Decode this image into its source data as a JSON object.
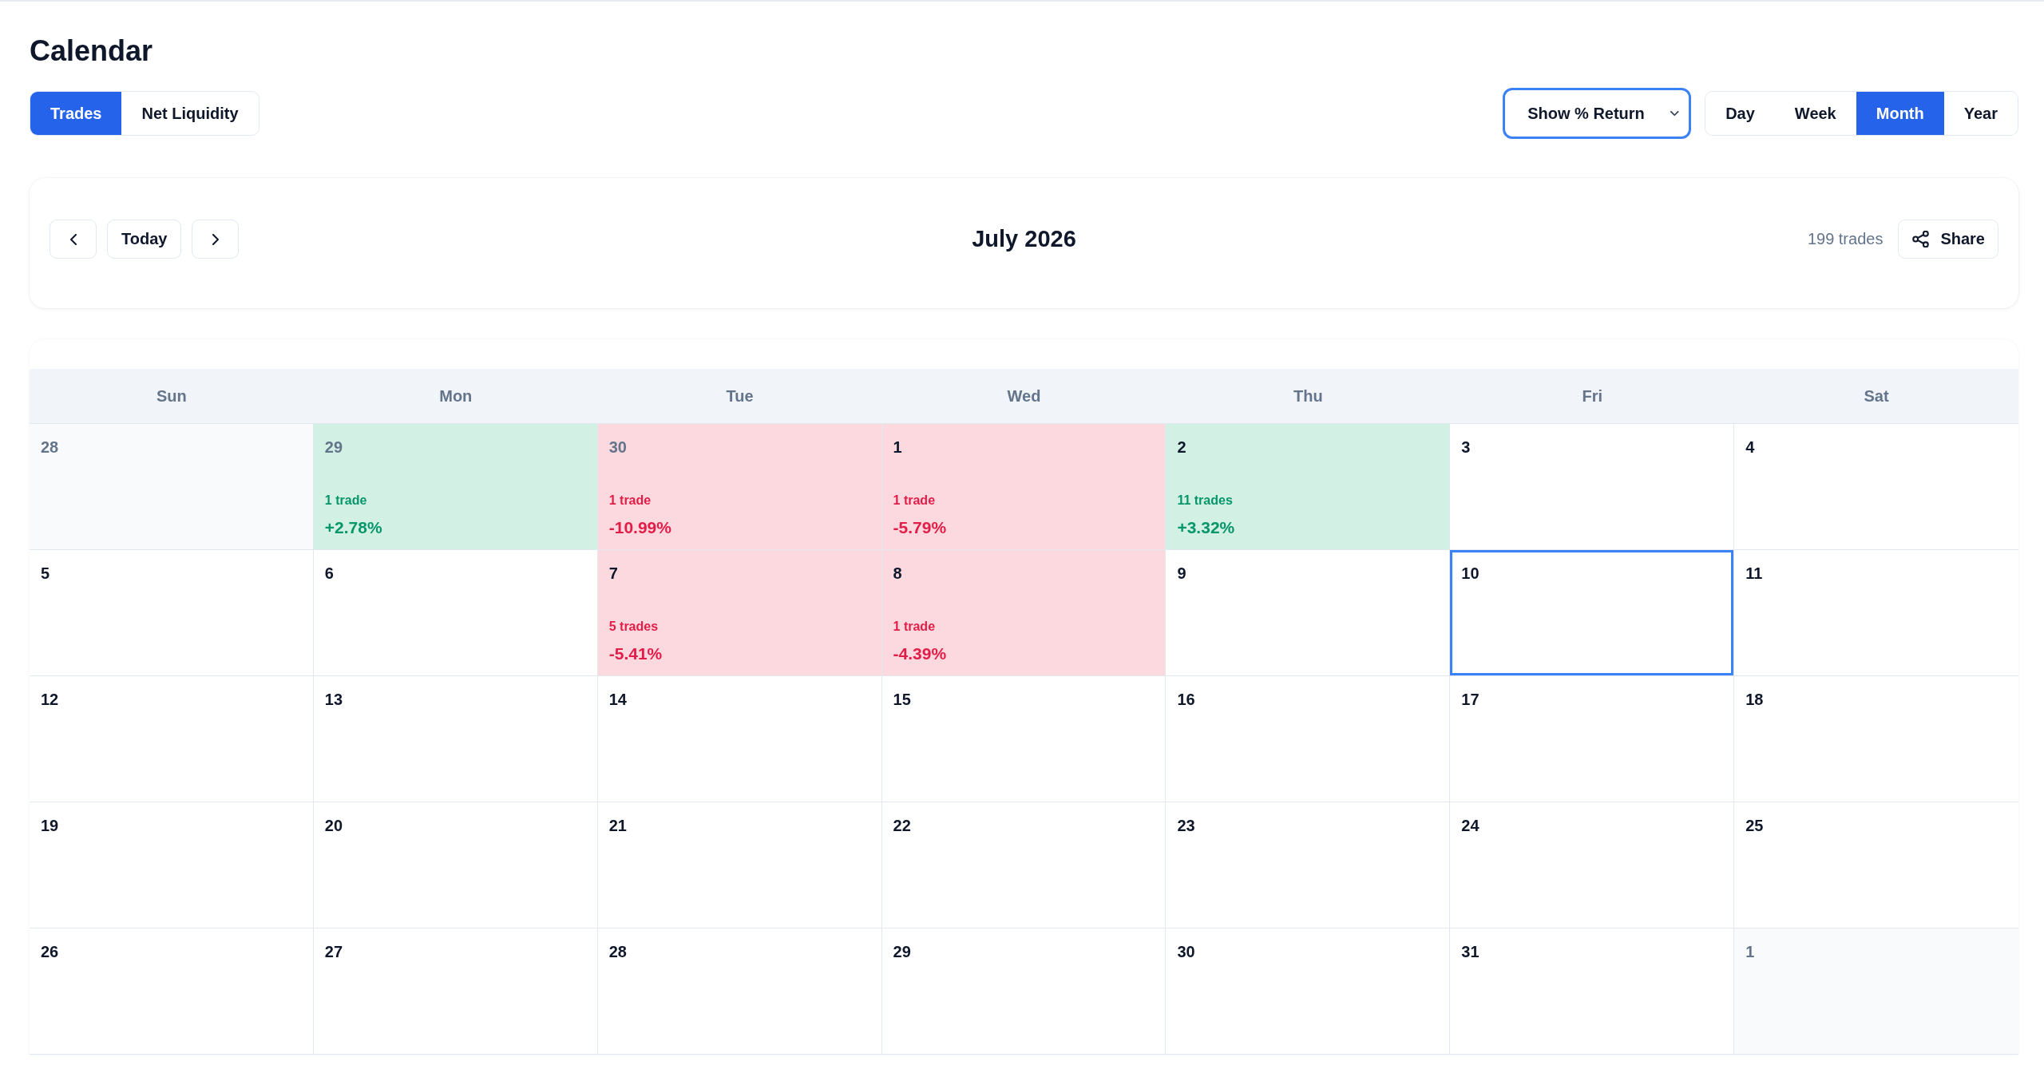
{
  "page": {
    "title": "Calendar"
  },
  "data_tabs": [
    {
      "label": "Trades",
      "selected": true
    },
    {
      "label": "Net Liquidity",
      "selected": false
    }
  ],
  "return_select": {
    "value": "Show % Return",
    "focused": true
  },
  "view_tabs": [
    {
      "label": "Day",
      "selected": false
    },
    {
      "label": "Week",
      "selected": false
    },
    {
      "label": "Month",
      "selected": true
    },
    {
      "label": "Year",
      "selected": false
    }
  ],
  "navigation": {
    "today_button": "Today",
    "month_title": "July 2026",
    "trade_total": "199 trades",
    "share_button": "Share"
  },
  "calendar": {
    "weekdays": [
      "Sun",
      "Mon",
      "Tue",
      "Wed",
      "Thu",
      "Fri",
      "Sat"
    ],
    "weeks": [
      {
        "days": [
          {
            "date": "28",
            "outside_month": true,
            "today": false,
            "kind": "plain"
          },
          {
            "date": "29",
            "outside_month": true,
            "today": false,
            "kind": "gain",
            "trades": "1 trade",
            "return": "+2.78%"
          },
          {
            "date": "30",
            "outside_month": true,
            "today": false,
            "kind": "loss",
            "trades": "1 trade",
            "return": "-10.99%"
          },
          {
            "date": "1",
            "outside_month": false,
            "today": false,
            "kind": "loss",
            "trades": "1 trade",
            "return": "-5.79%"
          },
          {
            "date": "2",
            "outside_month": false,
            "today": false,
            "kind": "gain",
            "trades": "11 trades",
            "return": "+3.32%"
          },
          {
            "date": "3",
            "outside_month": false,
            "today": false,
            "kind": "plain"
          },
          {
            "date": "4",
            "outside_month": false,
            "today": false,
            "kind": "plain"
          }
        ]
      },
      {
        "days": [
          {
            "date": "5",
            "outside_month": false,
            "today": false,
            "kind": "plain"
          },
          {
            "date": "6",
            "outside_month": false,
            "today": false,
            "kind": "plain"
          },
          {
            "date": "7",
            "outside_month": false,
            "today": false,
            "kind": "loss",
            "trades": "5 trades",
            "return": "-5.41%"
          },
          {
            "date": "8",
            "outside_month": false,
            "today": false,
            "kind": "loss",
            "trades": "1 trade",
            "return": "-4.39%"
          },
          {
            "date": "9",
            "outside_month": false,
            "today": false,
            "kind": "plain"
          },
          {
            "date": "10",
            "outside_month": false,
            "today": true,
            "kind": "plain"
          },
          {
            "date": "11",
            "outside_month": false,
            "today": false,
            "kind": "plain"
          }
        ]
      },
      {
        "days": [
          {
            "date": "12",
            "outside_month": false,
            "today": false,
            "kind": "plain"
          },
          {
            "date": "13",
            "outside_month": false,
            "today": false,
            "kind": "plain"
          },
          {
            "date": "14",
            "outside_month": false,
            "today": false,
            "kind": "plain"
          },
          {
            "date": "15",
            "outside_month": false,
            "today": false,
            "kind": "plain"
          },
          {
            "date": "16",
            "outside_month": false,
            "today": false,
            "kind": "plain"
          },
          {
            "date": "17",
            "outside_month": false,
            "today": false,
            "kind": "plain"
          },
          {
            "date": "18",
            "outside_month": false,
            "today": false,
            "kind": "plain"
          }
        ]
      },
      {
        "days": [
          {
            "date": "19",
            "outside_month": false,
            "today": false,
            "kind": "plain"
          },
          {
            "date": "20",
            "outside_month": false,
            "today": false,
            "kind": "plain"
          },
          {
            "date": "21",
            "outside_month": false,
            "today": false,
            "kind": "plain"
          },
          {
            "date": "22",
            "outside_month": false,
            "today": false,
            "kind": "plain"
          },
          {
            "date": "23",
            "outside_month": false,
            "today": false,
            "kind": "plain"
          },
          {
            "date": "24",
            "outside_month": false,
            "today": false,
            "kind": "plain"
          },
          {
            "date": "25",
            "outside_month": false,
            "today": false,
            "kind": "plain"
          }
        ]
      },
      {
        "days": [
          {
            "date": "26",
            "outside_month": false,
            "today": false,
            "kind": "plain"
          },
          {
            "date": "27",
            "outside_month": false,
            "today": false,
            "kind": "plain"
          },
          {
            "date": "28",
            "outside_month": false,
            "today": false,
            "kind": "plain"
          },
          {
            "date": "29",
            "outside_month": false,
            "today": false,
            "kind": "plain"
          },
          {
            "date": "30",
            "outside_month": false,
            "today": false,
            "kind": "plain"
          },
          {
            "date": "31",
            "outside_month": false,
            "today": false,
            "kind": "plain"
          },
          {
            "date": "1",
            "outside_month": true,
            "today": false,
            "kind": "plain"
          }
        ]
      }
    ]
  }
}
